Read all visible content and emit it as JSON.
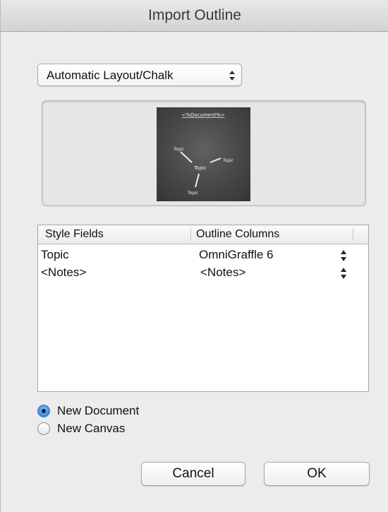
{
  "dialog": {
    "title": "Import Outline"
  },
  "layout_popup": {
    "selected": "Automatic Layout/Chalk"
  },
  "preview": {
    "document_label": "<%Document%>",
    "topics": [
      "Topic",
      "Topic",
      "Topic",
      "Topic"
    ]
  },
  "table": {
    "columns": [
      "Style Fields",
      "Outline Columns"
    ],
    "rows": [
      {
        "style_field": "Topic",
        "outline_column": "OmniGraffle 6"
      },
      {
        "style_field": "<Notes>",
        "outline_column": "<Notes>"
      }
    ]
  },
  "destination": {
    "options": [
      {
        "label": "New Document",
        "selected": true
      },
      {
        "label": "New Canvas",
        "selected": false
      }
    ]
  },
  "buttons": {
    "cancel": "Cancel",
    "ok": "OK"
  }
}
